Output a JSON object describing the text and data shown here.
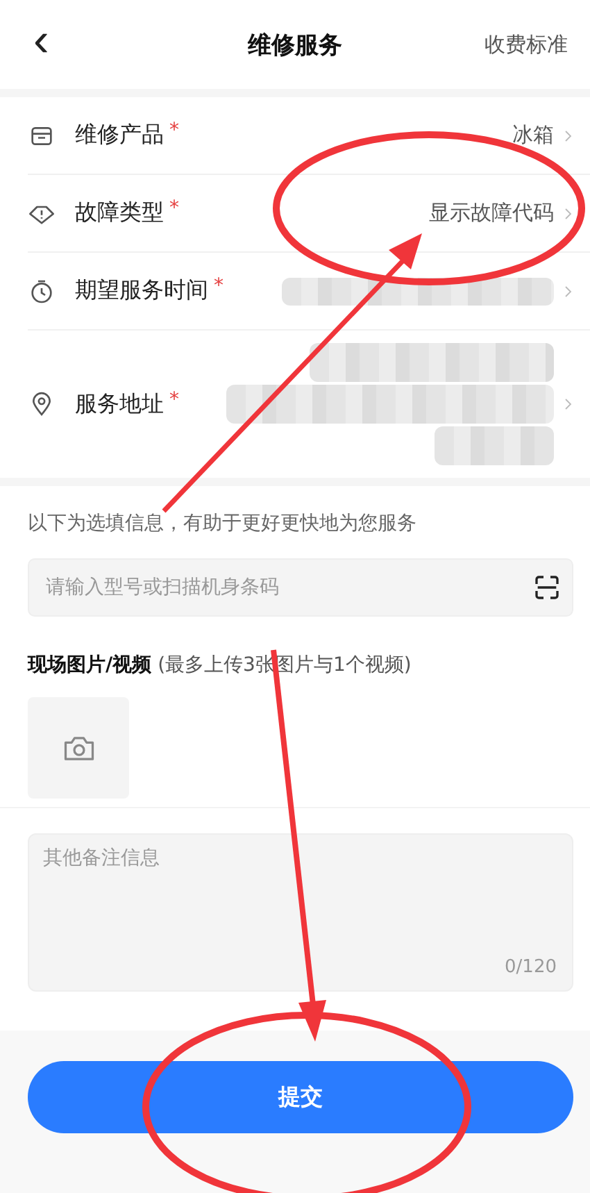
{
  "header": {
    "back": "‹",
    "title": "维修服务",
    "action": "收费标准"
  },
  "fields": [
    {
      "kind": "product",
      "label": "维修产品",
      "required_mark": "*",
      "value": "冰箱"
    },
    {
      "kind": "fault",
      "label": "故障类型",
      "required_mark": "*",
      "value": "显示故障代码"
    },
    {
      "kind": "time",
      "label": "期望服务时间",
      "required_mark": "*",
      "blurred": true
    },
    {
      "kind": "address",
      "label": "服务地址",
      "required_mark": "*",
      "blurred": true
    }
  ],
  "optional": {
    "note": "以下为选填信息，有助于更好更快地为您服务",
    "model_field": {
      "placeholder": "请输入型号或扫描机身条码"
    },
    "media": {
      "label": "现场图片/视频",
      "hint": " (最多上传3张图片与1个视频)"
    },
    "remarks": {
      "placeholder": "其他备注信息",
      "counter": "0/120"
    }
  },
  "submit": "提交"
}
